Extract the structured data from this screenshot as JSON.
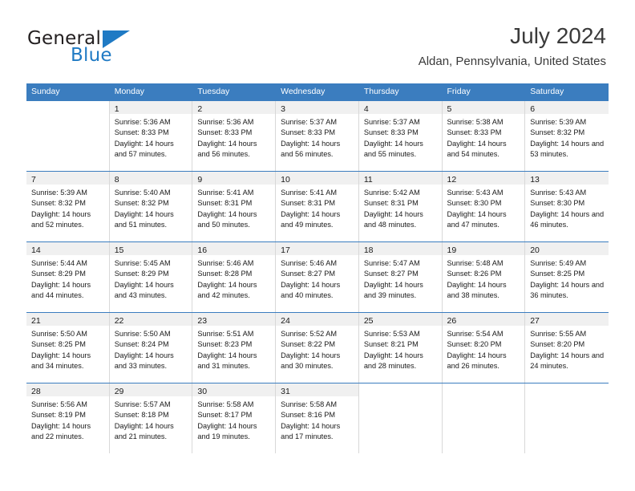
{
  "brand": {
    "name_part1": "General",
    "name_part2": "Blue",
    "accent_color": "#1f7ac4"
  },
  "header": {
    "month_title": "July 2024",
    "location": "Aldan, Pennsylvania, United States"
  },
  "calendar": {
    "header_color": "#3b7dbf",
    "weekdays": [
      "Sunday",
      "Monday",
      "Tuesday",
      "Wednesday",
      "Thursday",
      "Friday",
      "Saturday"
    ],
    "weeks": [
      [
        {
          "day": "",
          "sunrise": "",
          "sunset": "",
          "daylight": "",
          "empty": true
        },
        {
          "day": "1",
          "sunrise": "Sunrise: 5:36 AM",
          "sunset": "Sunset: 8:33 PM",
          "daylight": "Daylight: 14 hours and 57 minutes."
        },
        {
          "day": "2",
          "sunrise": "Sunrise: 5:36 AM",
          "sunset": "Sunset: 8:33 PM",
          "daylight": "Daylight: 14 hours and 56 minutes."
        },
        {
          "day": "3",
          "sunrise": "Sunrise: 5:37 AM",
          "sunset": "Sunset: 8:33 PM",
          "daylight": "Daylight: 14 hours and 56 minutes."
        },
        {
          "day": "4",
          "sunrise": "Sunrise: 5:37 AM",
          "sunset": "Sunset: 8:33 PM",
          "daylight": "Daylight: 14 hours and 55 minutes."
        },
        {
          "day": "5",
          "sunrise": "Sunrise: 5:38 AM",
          "sunset": "Sunset: 8:33 PM",
          "daylight": "Daylight: 14 hours and 54 minutes."
        },
        {
          "day": "6",
          "sunrise": "Sunrise: 5:39 AM",
          "sunset": "Sunset: 8:32 PM",
          "daylight": "Daylight: 14 hours and 53 minutes."
        }
      ],
      [
        {
          "day": "7",
          "sunrise": "Sunrise: 5:39 AM",
          "sunset": "Sunset: 8:32 PM",
          "daylight": "Daylight: 14 hours and 52 minutes."
        },
        {
          "day": "8",
          "sunrise": "Sunrise: 5:40 AM",
          "sunset": "Sunset: 8:32 PM",
          "daylight": "Daylight: 14 hours and 51 minutes."
        },
        {
          "day": "9",
          "sunrise": "Sunrise: 5:41 AM",
          "sunset": "Sunset: 8:31 PM",
          "daylight": "Daylight: 14 hours and 50 minutes."
        },
        {
          "day": "10",
          "sunrise": "Sunrise: 5:41 AM",
          "sunset": "Sunset: 8:31 PM",
          "daylight": "Daylight: 14 hours and 49 minutes."
        },
        {
          "day": "11",
          "sunrise": "Sunrise: 5:42 AM",
          "sunset": "Sunset: 8:31 PM",
          "daylight": "Daylight: 14 hours and 48 minutes."
        },
        {
          "day": "12",
          "sunrise": "Sunrise: 5:43 AM",
          "sunset": "Sunset: 8:30 PM",
          "daylight": "Daylight: 14 hours and 47 minutes."
        },
        {
          "day": "13",
          "sunrise": "Sunrise: 5:43 AM",
          "sunset": "Sunset: 8:30 PM",
          "daylight": "Daylight: 14 hours and 46 minutes."
        }
      ],
      [
        {
          "day": "14",
          "sunrise": "Sunrise: 5:44 AM",
          "sunset": "Sunset: 8:29 PM",
          "daylight": "Daylight: 14 hours and 44 minutes."
        },
        {
          "day": "15",
          "sunrise": "Sunrise: 5:45 AM",
          "sunset": "Sunset: 8:29 PM",
          "daylight": "Daylight: 14 hours and 43 minutes."
        },
        {
          "day": "16",
          "sunrise": "Sunrise: 5:46 AM",
          "sunset": "Sunset: 8:28 PM",
          "daylight": "Daylight: 14 hours and 42 minutes."
        },
        {
          "day": "17",
          "sunrise": "Sunrise: 5:46 AM",
          "sunset": "Sunset: 8:27 PM",
          "daylight": "Daylight: 14 hours and 40 minutes."
        },
        {
          "day": "18",
          "sunrise": "Sunrise: 5:47 AM",
          "sunset": "Sunset: 8:27 PM",
          "daylight": "Daylight: 14 hours and 39 minutes."
        },
        {
          "day": "19",
          "sunrise": "Sunrise: 5:48 AM",
          "sunset": "Sunset: 8:26 PM",
          "daylight": "Daylight: 14 hours and 38 minutes."
        },
        {
          "day": "20",
          "sunrise": "Sunrise: 5:49 AM",
          "sunset": "Sunset: 8:25 PM",
          "daylight": "Daylight: 14 hours and 36 minutes."
        }
      ],
      [
        {
          "day": "21",
          "sunrise": "Sunrise: 5:50 AM",
          "sunset": "Sunset: 8:25 PM",
          "daylight": "Daylight: 14 hours and 34 minutes."
        },
        {
          "day": "22",
          "sunrise": "Sunrise: 5:50 AM",
          "sunset": "Sunset: 8:24 PM",
          "daylight": "Daylight: 14 hours and 33 minutes."
        },
        {
          "day": "23",
          "sunrise": "Sunrise: 5:51 AM",
          "sunset": "Sunset: 8:23 PM",
          "daylight": "Daylight: 14 hours and 31 minutes."
        },
        {
          "day": "24",
          "sunrise": "Sunrise: 5:52 AM",
          "sunset": "Sunset: 8:22 PM",
          "daylight": "Daylight: 14 hours and 30 minutes."
        },
        {
          "day": "25",
          "sunrise": "Sunrise: 5:53 AM",
          "sunset": "Sunset: 8:21 PM",
          "daylight": "Daylight: 14 hours and 28 minutes."
        },
        {
          "day": "26",
          "sunrise": "Sunrise: 5:54 AM",
          "sunset": "Sunset: 8:20 PM",
          "daylight": "Daylight: 14 hours and 26 minutes."
        },
        {
          "day": "27",
          "sunrise": "Sunrise: 5:55 AM",
          "sunset": "Sunset: 8:20 PM",
          "daylight": "Daylight: 14 hours and 24 minutes."
        }
      ],
      [
        {
          "day": "28",
          "sunrise": "Sunrise: 5:56 AM",
          "sunset": "Sunset: 8:19 PM",
          "daylight": "Daylight: 14 hours and 22 minutes."
        },
        {
          "day": "29",
          "sunrise": "Sunrise: 5:57 AM",
          "sunset": "Sunset: 8:18 PM",
          "daylight": "Daylight: 14 hours and 21 minutes."
        },
        {
          "day": "30",
          "sunrise": "Sunrise: 5:58 AM",
          "sunset": "Sunset: 8:17 PM",
          "daylight": "Daylight: 14 hours and 19 minutes."
        },
        {
          "day": "31",
          "sunrise": "Sunrise: 5:58 AM",
          "sunset": "Sunset: 8:16 PM",
          "daylight": "Daylight: 14 hours and 17 minutes."
        },
        {
          "day": "",
          "sunrise": "",
          "sunset": "",
          "daylight": "",
          "empty": true
        },
        {
          "day": "",
          "sunrise": "",
          "sunset": "",
          "daylight": "",
          "empty": true
        },
        {
          "day": "",
          "sunrise": "",
          "sunset": "",
          "daylight": "",
          "empty": true
        }
      ]
    ]
  }
}
